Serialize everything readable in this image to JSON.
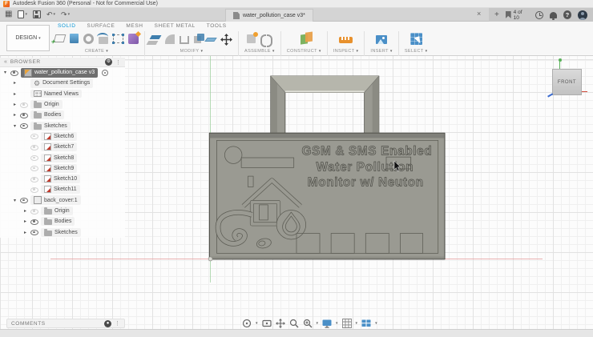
{
  "title_bar": {
    "app_title": "Autodesk Fusion 360 (Personal - Not for Commercial Use)"
  },
  "qat": {
    "icons": [
      "app-grid",
      "file-new",
      "save",
      "undo",
      "redo"
    ]
  },
  "tab_bar": {
    "tab_label": "water_pollution_case v3*",
    "close": "×",
    "new_tab": "+",
    "doc_badge": "4 of 10",
    "right_icons": [
      "job-status-flag",
      "clock",
      "notifications-bell",
      "help",
      "user-avatar"
    ]
  },
  "ribbon": {
    "design_label": "DESIGN",
    "tabs": [
      {
        "label": "SOLID",
        "active": true
      },
      {
        "label": "SURFACE",
        "active": false
      },
      {
        "label": "MESH",
        "active": false
      },
      {
        "label": "SHEET METAL",
        "active": false
      },
      {
        "label": "TOOLS",
        "active": false
      }
    ],
    "groups": [
      {
        "label": "CREATE",
        "icons": [
          "create-sketch",
          "extrude",
          "revolve",
          "sweep",
          "form-box",
          "create-form"
        ]
      },
      {
        "label": "MODIFY",
        "icons": [
          "press-pull",
          "fillet",
          "shell",
          "combine",
          "offset-face",
          "move"
        ]
      },
      {
        "label": "ASSEMBLE",
        "icons": [
          "new-component",
          "joint"
        ]
      },
      {
        "label": "CONSTRUCT",
        "icons": [
          "construction-plane"
        ]
      },
      {
        "label": "INSPECT",
        "icons": [
          "measure"
        ]
      },
      {
        "label": "INSERT",
        "icons": [
          "insert-image"
        ]
      },
      {
        "label": "SELECT",
        "icons": [
          "select"
        ]
      }
    ],
    "accent_color": "#0696d7"
  },
  "browser": {
    "title": "BROWSER",
    "items": [
      {
        "level": 0,
        "arrow": "exp",
        "eye": "on",
        "icon": "component",
        "label": "water_pollution_case v3",
        "selected": true,
        "radio": true
      },
      {
        "level": 1,
        "arrow": "col",
        "eye": "",
        "icon": "gear",
        "label": "Document Settings"
      },
      {
        "level": 1,
        "arrow": "col",
        "eye": "",
        "icon": "views",
        "label": "Named Views"
      },
      {
        "level": 1,
        "arrow": "col",
        "eye": "dim",
        "icon": "folder",
        "label": "Origin"
      },
      {
        "level": 1,
        "arrow": "col",
        "eye": "on",
        "icon": "folder",
        "label": "Bodies"
      },
      {
        "level": 1,
        "arrow": "exp",
        "eye": "on",
        "icon": "folder",
        "label": "Sketches"
      },
      {
        "level": 2,
        "arrow": "",
        "eye": "dim",
        "icon": "sketch",
        "label": "Sketch6"
      },
      {
        "level": 2,
        "arrow": "",
        "eye": "dim",
        "icon": "sketch",
        "label": "Sketch7"
      },
      {
        "level": 2,
        "arrow": "",
        "eye": "dim",
        "icon": "sketch",
        "label": "Sketch8"
      },
      {
        "level": 2,
        "arrow": "",
        "eye": "dim",
        "icon": "sketch",
        "label": "Sketch9"
      },
      {
        "level": 2,
        "arrow": "",
        "eye": "dim",
        "icon": "sketch",
        "label": "Sketch10"
      },
      {
        "level": 2,
        "arrow": "",
        "eye": "dim",
        "icon": "sketch",
        "label": "Sketch11"
      },
      {
        "level": 1,
        "arrow": "exp",
        "eye": "on",
        "icon": "component2",
        "label": "back_cover:1"
      },
      {
        "level": 2,
        "arrow": "col",
        "eye": "dim",
        "icon": "folder",
        "label": "Origin"
      },
      {
        "level": 2,
        "arrow": "col",
        "eye": "on",
        "icon": "folder",
        "label": "Bodies"
      },
      {
        "level": 2,
        "arrow": "col",
        "eye": "on",
        "icon": "folder",
        "label": "Sketches"
      }
    ]
  },
  "viewcube": {
    "face_label": "FRONT"
  },
  "model": {
    "engraving_lines": [
      "GSM & SMS Enabled",
      "Water Pollution",
      "Monitor w/ Neuton"
    ],
    "body_color": "#9a9a92",
    "outline_color": "#45453f",
    "engraving_color": "#5c5c54",
    "axis_red": "#e59a9a",
    "axis_green": "#9ccf9c"
  },
  "comments": {
    "label": "COMMENTS"
  },
  "nav_bar": {
    "icons": [
      "orbit",
      "look-at",
      "pan",
      "zoom",
      "fit",
      "display-settings",
      "grid-snaps",
      "viewports"
    ]
  }
}
